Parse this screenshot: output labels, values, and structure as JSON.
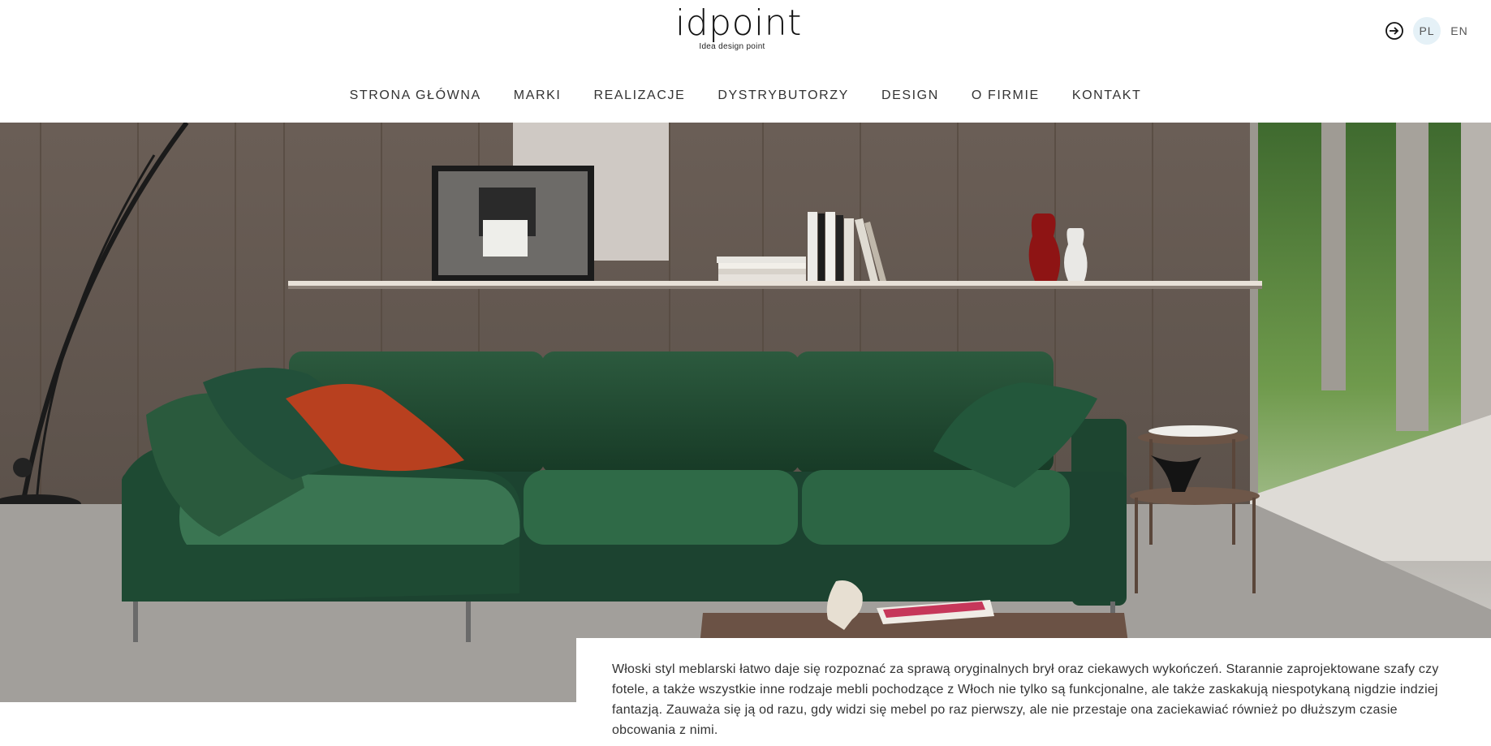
{
  "brand": {
    "logo_text": "idpoint",
    "tagline": "Idea design point"
  },
  "header": {
    "login_icon": "login-arrow-icon",
    "languages": [
      {
        "label": "PL",
        "active": true
      },
      {
        "label": "EN",
        "active": false
      }
    ]
  },
  "nav": {
    "items": [
      {
        "label": "STRONA GŁÓWNA"
      },
      {
        "label": "MARKI"
      },
      {
        "label": "REALIZACJE"
      },
      {
        "label": "DYSTRYBUTORZY"
      },
      {
        "label": "DESIGN"
      },
      {
        "label": "O FIRMIE"
      },
      {
        "label": "KONTAKT"
      }
    ]
  },
  "hero": {
    "image": "living-room-green-sofa-photo"
  },
  "intro": {
    "text": "Włoski styl meblarski łatwo daje się rozpoznać za sprawą oryginalnych brył oraz ciekawych wykończeń. Starannie zaprojektowane szafy czy fotele, a także wszystkie inne rodzaje mebli pochodzące z Włoch nie tylko są funkcjonalne, ale także zaskakują niespotykaną nigdzie indziej fantazją. Zauważa się ją od razu, gdy widzi się mebel po raz pierwszy, ale nie przestaje ona zaciekawiać również po dłuższym czasie obcowania z nimi."
  },
  "colors": {
    "sofa": "#1f4a32",
    "wall": "#6e625a",
    "pillow": "#b8401f",
    "active_lang_bg": "#e5f1f7"
  }
}
